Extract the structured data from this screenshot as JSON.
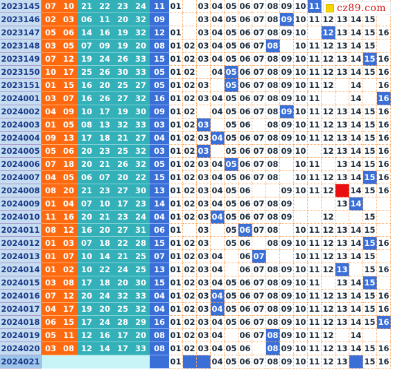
{
  "site_logo": "cz89.com",
  "rows": [
    {
      "period": "2023145",
      "reds": [
        "07",
        "10",
        "21",
        "22",
        "23",
        "24"
      ],
      "blue": "11",
      "cells": [
        "01",
        "",
        "03",
        "04",
        "05",
        "06",
        "07",
        "08",
        "09",
        "10",
        "11",
        "",
        "",
        "",
        " ",
        ""
      ],
      "hits": [
        11
      ]
    },
    {
      "period": "2023146",
      "reds": [
        "02",
        "03",
        "06",
        "11",
        "20",
        "32"
      ],
      "blue": "09",
      "cells": [
        "",
        "",
        "03",
        "04",
        "05",
        "06",
        "07",
        "08",
        "09",
        "10",
        "11",
        "12",
        "13",
        "14",
        "15",
        ""
      ],
      "hits": [
        9
      ]
    },
    {
      "period": "2023147",
      "reds": [
        "05",
        "06",
        "14",
        "16",
        "19",
        "32"
      ],
      "blue": "12",
      "cells": [
        "01",
        "",
        "03",
        "04",
        "05",
        "06",
        "07",
        "08",
        "09",
        "10",
        "",
        "12",
        "13",
        "14",
        "15",
        "16"
      ],
      "hits": [
        12
      ]
    },
    {
      "period": "2023148",
      "reds": [
        "03",
        "05",
        "07",
        "09",
        "19",
        "20"
      ],
      "blue": "08",
      "cells": [
        "01",
        "02",
        "03",
        "04",
        "05",
        "06",
        "07",
        "08",
        "",
        "10",
        "11",
        "12",
        "13",
        "14",
        "15",
        ""
      ],
      "hits": [
        8
      ]
    },
    {
      "period": "2023149",
      "reds": [
        "07",
        "12",
        "19",
        "24",
        "26",
        "33"
      ],
      "blue": "15",
      "cells": [
        "01",
        "02",
        "03",
        "04",
        "05",
        "06",
        "07",
        "08",
        "09",
        "10",
        "11",
        "12",
        "13",
        "14",
        "15",
        "16"
      ],
      "hits": [
        15
      ]
    },
    {
      "period": "2023150",
      "reds": [
        "10",
        "17",
        "25",
        "26",
        "30",
        "33"
      ],
      "blue": "05",
      "cells": [
        "01",
        "02",
        "",
        "04",
        "05",
        "06",
        "07",
        "08",
        "09",
        "10",
        "11",
        "12",
        "13",
        "14",
        "15",
        "16"
      ],
      "hits": [
        5
      ]
    },
    {
      "period": "2023151",
      "reds": [
        "01",
        "15",
        "16",
        "20",
        "25",
        "27"
      ],
      "blue": "05",
      "cells": [
        "01",
        "02",
        "03",
        "",
        "05",
        "06",
        "07",
        "08",
        "09",
        "10",
        "11",
        "12",
        "",
        "14",
        "",
        "16"
      ],
      "hits": [
        5
      ]
    },
    {
      "period": "2024001",
      "reds": [
        "03",
        "07",
        "16",
        "26",
        "27",
        "32"
      ],
      "blue": "16",
      "cells": [
        "01",
        "02",
        "03",
        "04",
        "05",
        "06",
        "07",
        "08",
        "09",
        "10",
        "11",
        "",
        "",
        "14",
        "",
        "16"
      ],
      "hits": [
        16
      ]
    },
    {
      "period": "2024002",
      "reds": [
        "04",
        "09",
        "10",
        "17",
        "19",
        "30"
      ],
      "blue": "09",
      "cells": [
        "01",
        "02",
        "",
        "04",
        "05",
        "06",
        "07",
        "08",
        "09",
        "10",
        "11",
        "12",
        "13",
        "14",
        "15",
        "16"
      ],
      "hits": [
        9
      ]
    },
    {
      "period": "2024003",
      "reds": [
        "01",
        "05",
        "08",
        "13",
        "32",
        "33"
      ],
      "blue": "03",
      "cells": [
        "01",
        "02",
        "03",
        "",
        "05",
        "06",
        "",
        "08",
        "09",
        "10",
        "11",
        "12",
        "13",
        "14",
        "15",
        "16"
      ],
      "hits": [
        3
      ]
    },
    {
      "period": "2024004",
      "reds": [
        "09",
        "13",
        "17",
        "18",
        "21",
        "27"
      ],
      "blue": "04",
      "cells": [
        "01",
        "02",
        "03",
        "04",
        "05",
        "06",
        "07",
        "08",
        "09",
        "10",
        "11",
        "12",
        "13",
        "14",
        "15",
        "16"
      ],
      "hits": [
        4
      ]
    },
    {
      "period": "2024005",
      "reds": [
        "05",
        "06",
        "20",
        "23",
        "25",
        "32"
      ],
      "blue": "03",
      "cells": [
        "01",
        "02",
        "03",
        "",
        "05",
        "06",
        "07",
        "08",
        "09",
        "10",
        "",
        "12",
        "13",
        "14",
        "15",
        "16"
      ],
      "hits": [
        3
      ]
    },
    {
      "period": "2024006",
      "reds": [
        "07",
        "18",
        "20",
        "21",
        "26",
        "32"
      ],
      "blue": "05",
      "cells": [
        "01",
        "02",
        "03",
        "04",
        "05",
        "06",
        "07",
        "08",
        "",
        "10",
        "11",
        "",
        "13",
        "14",
        "15",
        "16"
      ],
      "hits": [
        5
      ]
    },
    {
      "period": "2024007",
      "reds": [
        "04",
        "05",
        "06",
        "07",
        "20",
        "22"
      ],
      "blue": "15",
      "cells": [
        "01",
        "02",
        "03",
        "04",
        "05",
        "06",
        "07",
        "08",
        "",
        "10",
        "11",
        "12",
        "13",
        "14",
        "15",
        "16"
      ],
      "hits": [
        15
      ]
    },
    {
      "period": "2024008",
      "reds": [
        "08",
        "20",
        "21",
        "23",
        "27",
        "30"
      ],
      "blue": "13",
      "cells": [
        "01",
        "02",
        "03",
        "04",
        "05",
        "06",
        "",
        "",
        "09",
        "10",
        "11",
        "12",
        "13",
        "14",
        "15",
        "16"
      ],
      "hits": [
        13
      ],
      "redhits": [
        13
      ]
    },
    {
      "period": "2024009",
      "reds": [
        "01",
        "04",
        "07",
        "10",
        "17",
        "23"
      ],
      "blue": "14",
      "cells": [
        "01",
        "02",
        "03",
        "04",
        "05",
        "06",
        "07",
        "08",
        "09",
        "",
        "",
        "",
        "13",
        "14",
        "",
        ""
      ],
      "hits": [
        14
      ]
    },
    {
      "period": "2024010",
      "reds": [
        "11",
        "16",
        "20",
        "21",
        "23",
        "24"
      ],
      "blue": "04",
      "cells": [
        "01",
        "02",
        "03",
        "04",
        "05",
        "06",
        "07",
        "08",
        "09",
        "",
        "",
        "12",
        "",
        "",
        "15",
        ""
      ],
      "hits": [
        4
      ]
    },
    {
      "period": "2024011",
      "reds": [
        "08",
        "12",
        "16",
        "20",
        "27",
        "31"
      ],
      "blue": "06",
      "cells": [
        "01",
        "",
        "03",
        "",
        "05",
        "06",
        "07",
        "08",
        "",
        "10",
        "11",
        "12",
        "13",
        "14",
        "15",
        ""
      ],
      "hits": [
        6
      ]
    },
    {
      "period": "2024012",
      "reds": [
        "01",
        "03",
        "07",
        "18",
        "22",
        "28"
      ],
      "blue": "15",
      "cells": [
        "01",
        "02",
        "03",
        "",
        "05",
        "06",
        "",
        "08",
        "09",
        "10",
        "11",
        "12",
        "13",
        "14",
        "15",
        "16"
      ],
      "hits": [
        15
      ]
    },
    {
      "period": "2024013",
      "reds": [
        "01",
        "07",
        "10",
        "14",
        "21",
        "25"
      ],
      "blue": "07",
      "cells": [
        "01",
        "02",
        "03",
        "04",
        "",
        "06",
        "07",
        "",
        "",
        "10",
        "11",
        "12",
        "13",
        "14",
        "15",
        ""
      ],
      "hits": [
        7
      ]
    },
    {
      "period": "2024014",
      "reds": [
        "01",
        "02",
        "10",
        "22",
        "24",
        "25"
      ],
      "blue": "13",
      "cells": [
        "01",
        "02",
        "03",
        "04",
        "",
        "06",
        "07",
        "08",
        "09",
        "10",
        "11",
        "12",
        "13",
        "",
        "15",
        "16"
      ],
      "hits": [
        13
      ]
    },
    {
      "period": "2024015",
      "reds": [
        "03",
        "08",
        "17",
        "18",
        "20",
        "30"
      ],
      "blue": "15",
      "cells": [
        "01",
        "02",
        "03",
        "04",
        "05",
        "06",
        "07",
        "08",
        "09",
        "10",
        "11",
        "",
        "13",
        "14",
        "15",
        ""
      ],
      "hits": [
        15
      ]
    },
    {
      "period": "2024016",
      "reds": [
        "07",
        "12",
        "20",
        "24",
        "32",
        "33"
      ],
      "blue": "04",
      "cells": [
        "01",
        "02",
        "03",
        "04",
        "05",
        "06",
        "07",
        "08",
        "09",
        "10",
        "11",
        "12",
        "13",
        "14",
        "15",
        "16"
      ],
      "hits": [
        4
      ]
    },
    {
      "period": "2024017",
      "reds": [
        "04",
        "17",
        "19",
        "20",
        "25",
        "32"
      ],
      "blue": "04",
      "cells": [
        "01",
        "02",
        "03",
        "04",
        "05",
        "06",
        "07",
        "08",
        "09",
        "10",
        "11",
        "12",
        "13",
        "14",
        "15",
        "16"
      ],
      "hits": [
        4
      ]
    },
    {
      "period": "2024018",
      "reds": [
        "06",
        "15",
        "17",
        "24",
        "28",
        "29"
      ],
      "blue": "16",
      "cells": [
        "01",
        "02",
        "03",
        "04",
        "05",
        "06",
        "07",
        "08",
        "09",
        "10",
        "11",
        "12",
        "13",
        "14",
        "15",
        "16"
      ],
      "hits": [
        16
      ]
    },
    {
      "period": "2024019",
      "reds": [
        "05",
        "11",
        "12",
        "16",
        "17",
        "20"
      ],
      "blue": "08",
      "cells": [
        "01",
        "02",
        "03",
        "04",
        "",
        "06",
        "07",
        "08",
        "09",
        "10",
        "11",
        "12",
        "",
        "14",
        "",
        ""
      ],
      "hits": [
        8
      ]
    },
    {
      "period": "2024020",
      "reds": [
        "03",
        "08",
        "12",
        "14",
        "17",
        "33"
      ],
      "blue": "08",
      "cells": [
        "01",
        "02",
        "03",
        "04",
        "05",
        "06",
        "",
        "08",
        "09",
        "10",
        "11",
        "12",
        "13",
        "14",
        "15",
        "16"
      ],
      "hits": [
        8
      ]
    },
    {
      "period": "2024021",
      "reds": [
        "",
        "",
        "",
        "",
        "",
        ""
      ],
      "blue": "",
      "cells": [
        "01",
        "",
        "",
        "04",
        "05",
        "06",
        "07",
        "08",
        "09",
        "10",
        "11",
        "12",
        "13",
        "",
        "15",
        "16"
      ],
      "hits": [
        2,
        3,
        14
      ],
      "latest": true
    }
  ]
}
